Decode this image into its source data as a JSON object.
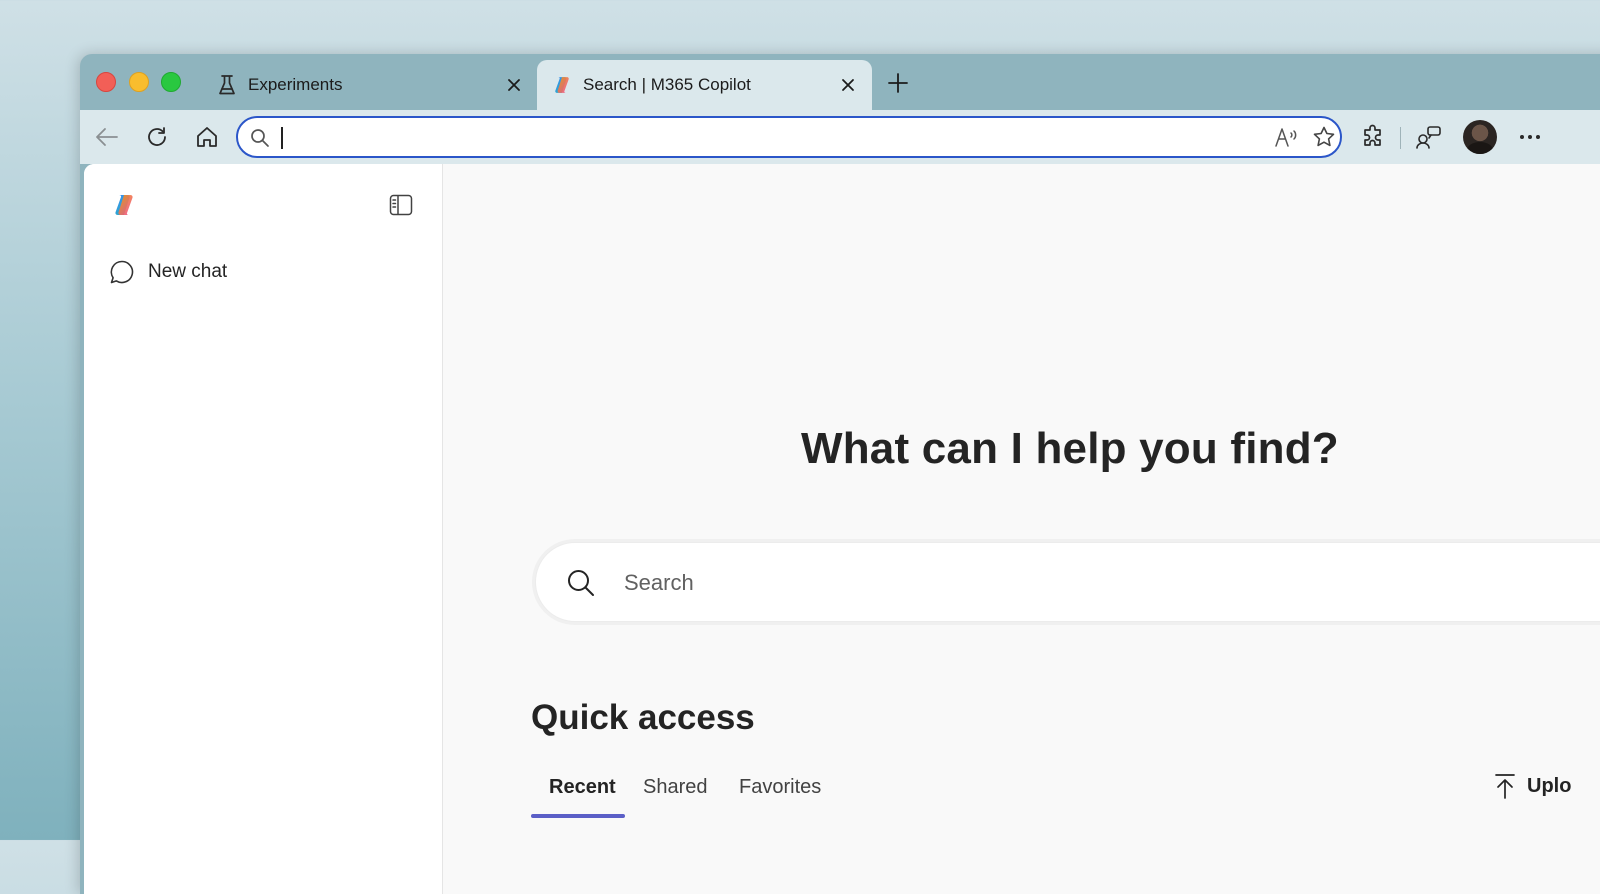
{
  "browser": {
    "tabs": [
      {
        "label": "Experiments",
        "icon": "flask-icon",
        "active": false
      },
      {
        "label": "Search | M365 Copilot",
        "icon": "copilot-logo-icon",
        "active": true
      }
    ],
    "address_bar": {
      "value": "",
      "placeholder": ""
    },
    "colors": {
      "address_border": "#2b56c9",
      "tab_active_bg": "#dbe8ec",
      "frame_bg": "#8fb4be"
    }
  },
  "sidebar": {
    "new_chat_label": "New chat"
  },
  "main": {
    "heading": "What can I help you find?",
    "search_placeholder": "Search",
    "quick_access": {
      "title": "Quick access",
      "tabs": [
        "Recent",
        "Shared",
        "Favorites"
      ],
      "active_tab": "Recent",
      "upload_label": "Uplo"
    },
    "accent_color": "#5b5fc7"
  }
}
